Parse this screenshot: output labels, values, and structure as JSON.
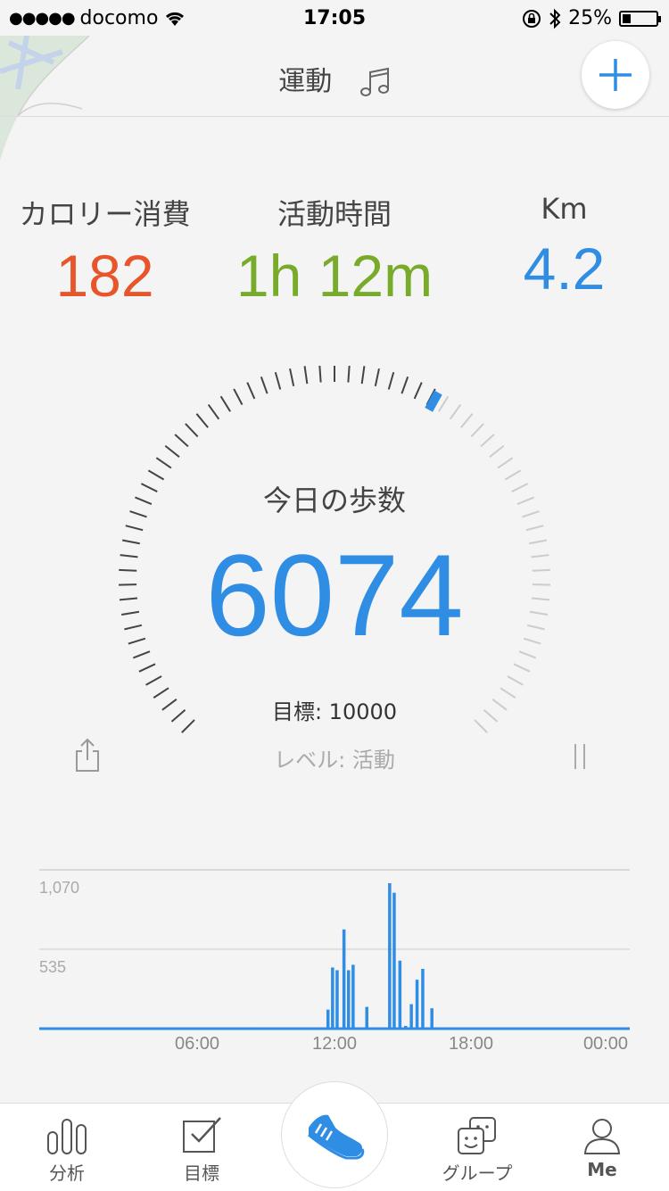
{
  "status_bar": {
    "carrier": "docomo",
    "time": "17:05",
    "battery": "25%"
  },
  "nav": {
    "title": "運動"
  },
  "stats": [
    {
      "label": "カロリー消費",
      "value": "182",
      "color": "#e8552a"
    },
    {
      "label": "活動時間",
      "value": "1h 12m",
      "color": "#78ab2a"
    },
    {
      "label": "Km",
      "value": "4.2",
      "color": "#2f8de4"
    }
  ],
  "dial": {
    "title": "今日の歩数",
    "steps": "6074",
    "goal": "目標: 10000",
    "level": "レベル: 活動",
    "progress": 0.6074
  },
  "colors": {
    "accent": "#2f8de4"
  },
  "chart_data": {
    "type": "bar",
    "x_labels": [
      "06:00",
      "12:00",
      "18:00",
      "00:00"
    ],
    "y_ticks": [
      "1,070",
      "535"
    ],
    "ylim": [
      0,
      1070
    ],
    "bars": [
      {
        "hour": 8.3,
        "value": 10
      },
      {
        "hour": 11.6,
        "value": 140
      },
      {
        "hour": 11.8,
        "value": 450
      },
      {
        "hour": 12.0,
        "value": 430
      },
      {
        "hour": 12.3,
        "value": 730
      },
      {
        "hour": 12.5,
        "value": 430
      },
      {
        "hour": 12.7,
        "value": 470
      },
      {
        "hour": 13.3,
        "value": 160
      },
      {
        "hour": 14.3,
        "value": 1070
      },
      {
        "hour": 14.5,
        "value": 1000
      },
      {
        "hour": 14.75,
        "value": 500
      },
      {
        "hour": 15.0,
        "value": 20
      },
      {
        "hour": 15.25,
        "value": 180
      },
      {
        "hour": 15.5,
        "value": 360
      },
      {
        "hour": 15.75,
        "value": 440
      },
      {
        "hour": 16.15,
        "value": 150
      }
    ]
  },
  "tabs": [
    {
      "label": "分析"
    },
    {
      "label": "目標"
    },
    {
      "label": "グループ"
    },
    {
      "label": "Me"
    }
  ]
}
